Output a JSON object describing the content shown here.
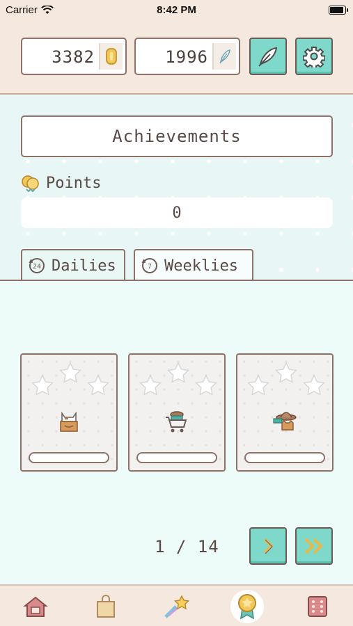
{
  "status": {
    "carrier": "Carrier",
    "time": "8:42 PM"
  },
  "header": {
    "coins": "3382",
    "feathers": "1996",
    "feather_button_icon": "feather-icon",
    "settings_button_icon": "gear-icon"
  },
  "main": {
    "title": "Achievements",
    "points_label": "Points",
    "points_value": "0",
    "tabs": [
      {
        "label": "Dailies",
        "icon": "clock-24-icon"
      },
      {
        "label": "Weeklies",
        "icon": "clock-7-icon"
      }
    ]
  },
  "cards": [
    {
      "art": "cat-in-box-icon",
      "stars_earned": 0,
      "progress": 0
    },
    {
      "art": "shopping-cart-icon",
      "stars_earned": 0,
      "progress": 0
    },
    {
      "art": "cat-with-hat-icon",
      "stars_earned": 0,
      "progress": 0
    }
  ],
  "pager": {
    "text": "1 / 14"
  },
  "tabbar": {
    "items": [
      "home-icon",
      "shopping-bag-icon",
      "shooting-star-icon",
      "achievement-medal-icon",
      "dice-icon"
    ],
    "active": "achievement-medal-icon"
  },
  "colors": {
    "accent": "#7fd9cb",
    "border": "#8c7268",
    "header_bg": "#f5e9df"
  }
}
